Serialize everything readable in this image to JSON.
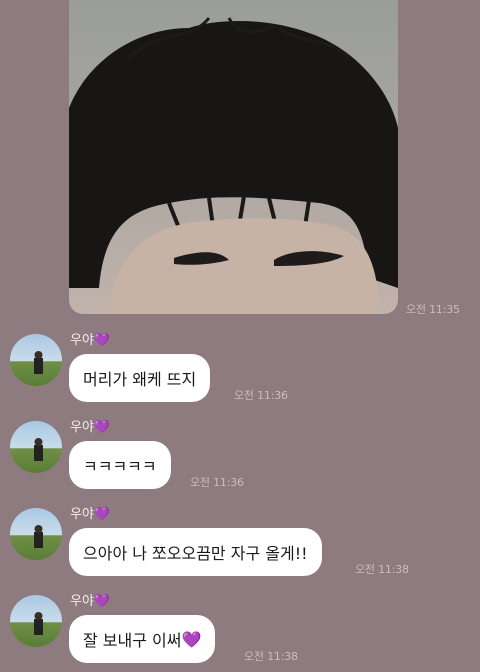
{
  "photo": {
    "timestamp": "오전 11:35",
    "alt": "hair-photo"
  },
  "messages": [
    {
      "sender": "우야",
      "heart": "💜",
      "text": "머리가 왜케 뜨지",
      "timestamp": "오전 11:36"
    },
    {
      "sender": "우야",
      "heart": "💜",
      "text": "ㅋㅋㅋㅋㅋ",
      "timestamp": "오전 11:36"
    },
    {
      "sender": "우야",
      "heart": "💜",
      "text": "으아아 나 쪼오오끔만 자구 올게!!",
      "timestamp": "오전 11:38"
    },
    {
      "sender": "우야",
      "heart": "💜",
      "text": "잘 보내구 이써",
      "text_emoji": "💜",
      "timestamp": "오전 11:38"
    }
  ],
  "colors": {
    "background": "#8e7b7f",
    "bubble": "#ffffff",
    "timestamp": "#c9bcbf",
    "heart": "#9b3bf0"
  }
}
